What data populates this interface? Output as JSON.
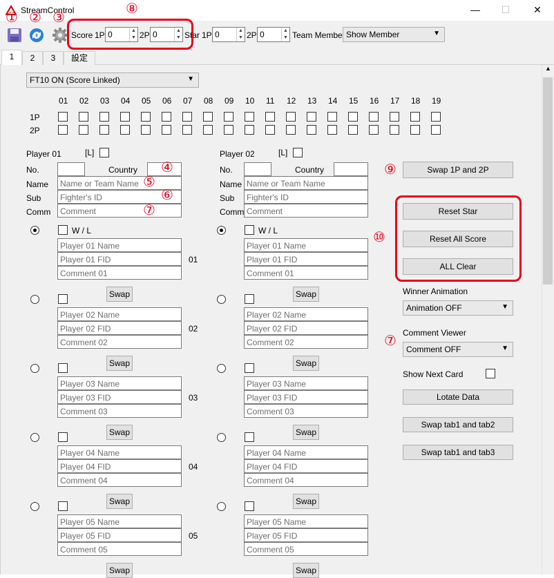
{
  "window": {
    "title": "StreamControl",
    "minimize": "—",
    "maximize": "☐",
    "close": "✕"
  },
  "annotations": {
    "a1": "①",
    "a2": "②",
    "a3": "③",
    "a4": "④",
    "a5": "⑤",
    "a6": "⑥",
    "a7": "⑦",
    "a7b": "⑦",
    "a8": "⑧",
    "a9": "⑨",
    "a10": "⑩"
  },
  "toolbar": {
    "score_label": "Score",
    "p1_label": "1P",
    "p2_label": "2P",
    "score_p1": "0",
    "score_p2": "0",
    "star_label": "Star",
    "star_p1_label": "1P",
    "star_p2_label": "2P",
    "star_p1": "0",
    "star_p2": "0",
    "team_member_label": "Team Member",
    "team_member_value": "Show Member"
  },
  "tabs": [
    "1",
    "2",
    "3",
    "設定"
  ],
  "ft_mode": "FT10 ON (Score Linked)",
  "games": [
    "01",
    "02",
    "03",
    "04",
    "05",
    "06",
    "07",
    "08",
    "09",
    "10",
    "11",
    "12",
    "13",
    "14",
    "15",
    "16",
    "17",
    "18",
    "19"
  ],
  "row_labels": [
    "1P",
    "2P"
  ],
  "player1": {
    "title": "Player 01",
    "l_label": "[L]",
    "no_label": "No.",
    "country_label": "Country",
    "name_label": "Name",
    "sub_label": "Sub",
    "comm_label": "Comm",
    "name_placeholder": "Name or Team Name",
    "sub_placeholder": "Fighter's ID",
    "comm_placeholder": "Comment",
    "wl_label": "W / L",
    "members": [
      {
        "name": "Player 01 Name",
        "fid": "Player 01 FID",
        "comment": "Comment 01",
        "num": "01"
      },
      {
        "name": "Player 02 Name",
        "fid": "Player 02 FID",
        "comment": "Comment 02",
        "num": "02"
      },
      {
        "name": "Player 03 Name",
        "fid": "Player 03 FID",
        "comment": "Comment 03",
        "num": "03"
      },
      {
        "name": "Player 04 Name",
        "fid": "Player 04 FID",
        "comment": "Comment 04",
        "num": "04"
      },
      {
        "name": "Player 05 Name",
        "fid": "Player 05 FID",
        "comment": "Comment 05",
        "num": "05"
      }
    ]
  },
  "player2": {
    "title": "Player 02",
    "l_label": "[L]",
    "no_label": "No.",
    "country_label": "Country",
    "name_label": "Name",
    "sub_label": "Sub",
    "comm_label": "Comm",
    "name_placeholder": "Name or Team Name",
    "sub_placeholder": "Fighter's ID",
    "comm_placeholder": "Comment",
    "wl_label": "W / L",
    "members": [
      {
        "name": "Player 01 Name",
        "fid": "Player 01 FID",
        "comment": "Comment 01"
      },
      {
        "name": "Player 02 Name",
        "fid": "Player 02 FID",
        "comment": "Comment 02"
      },
      {
        "name": "Player 03 Name",
        "fid": "Player 03 FID",
        "comment": "Comment 03"
      },
      {
        "name": "Player 04 Name",
        "fid": "Player 04 FID",
        "comment": "Comment 04"
      },
      {
        "name": "Player 05 Name",
        "fid": "Player 05 FID",
        "comment": "Comment 05"
      }
    ]
  },
  "swap_label": "Swap",
  "right": {
    "swap_players": "Swap 1P and 2P",
    "reset_star": "Reset Star",
    "reset_all_score": "Reset All Score",
    "all_clear": "ALL Clear",
    "winner_anim_label": "Winner Animation",
    "winner_anim_value": "Animation OFF",
    "comment_viewer_label": "Comment Viewer",
    "comment_viewer_value": "Comment OFF",
    "show_next_card": "Show Next Card",
    "lotate_data": "Lotate Data",
    "swap_tab12": "Swap tab1 and tab2",
    "swap_tab13": "Swap tab1 and tab3"
  },
  "colors": {
    "annotation_red": "#e8001c",
    "panel_bg": "#f0f0f0",
    "button_bg": "#e1e1e1"
  },
  "icons": [
    "app-logo-icon",
    "save-icon",
    "refresh-icon",
    "settings-gear-icon"
  ]
}
